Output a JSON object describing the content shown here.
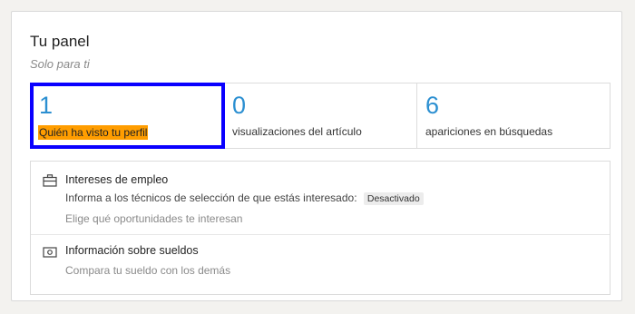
{
  "panel": {
    "title": "Tu panel",
    "subtitle": "Solo para ti"
  },
  "stats": [
    {
      "value": "1",
      "label": "Quién ha visto tu perfil",
      "highlighted": true
    },
    {
      "value": "0",
      "label": "visualizaciones del artículo"
    },
    {
      "value": "6",
      "label": "apariciones en búsquedas"
    }
  ],
  "job_interests": {
    "icon": "briefcase-icon",
    "title": "Intereses de empleo",
    "text": "Informa a los técnicos de selección de que estás interesado:",
    "status": "Desactivado",
    "link": "Elige qué oportunidades te interesan"
  },
  "salary": {
    "icon": "banknote-icon",
    "title": "Información sobre sueldos",
    "link": "Compara tu sueldo con los demás"
  },
  "colors": {
    "accent": "#2b8fd1",
    "highlight_outline": "#0a00ff",
    "highlight_label": "#ff9d00"
  }
}
